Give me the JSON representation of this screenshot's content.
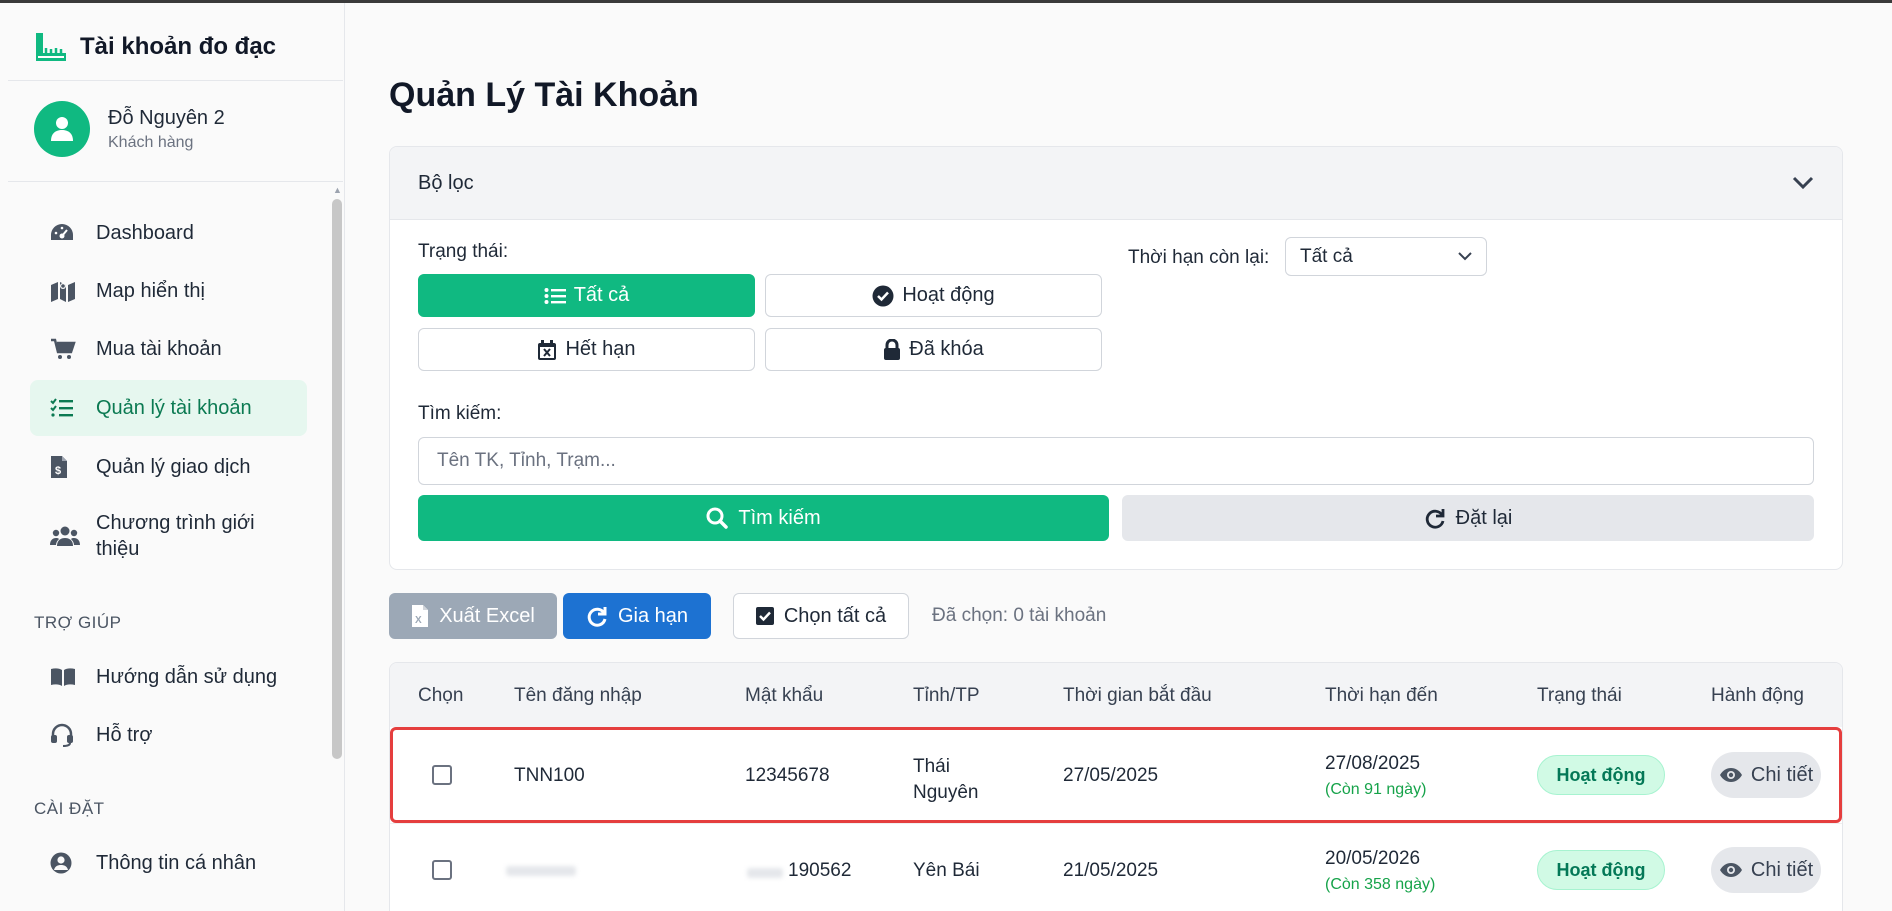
{
  "sidebar": {
    "brand_title": "Tài khoản đo đạc",
    "user": {
      "name": "Đỗ Nguyên 2",
      "role": "Khách hàng"
    },
    "items": [
      {
        "label": "Dashboard",
        "icon": "dashboard-gauge-icon"
      },
      {
        "label": "Map hiển thị",
        "icon": "map-icon"
      },
      {
        "label": "Mua tài khoản",
        "icon": "cart-icon"
      },
      {
        "label": "Quản lý tài khoản",
        "icon": "list-check-icon",
        "active": true
      },
      {
        "label": "Quản lý giao dịch",
        "icon": "invoice-icon"
      },
      {
        "label": "Chương trình giới thiệu",
        "label_line1": "Chương trình giới",
        "label_line2": "thiệu",
        "icon": "users-icon"
      }
    ],
    "help_section": "TRỢ GIÚP",
    "help_items": [
      {
        "label": "Hướng dẫn sử dụng",
        "icon": "book-icon"
      },
      {
        "label": "Hỗ trợ",
        "icon": "headset-icon"
      }
    ],
    "settings_section": "CÀI ĐẶT",
    "settings_items": [
      {
        "label": "Thông tin cá nhân",
        "icon": "user-circle-icon"
      }
    ]
  },
  "main": {
    "title": "Quản Lý Tài Khoản",
    "filter": {
      "header": "Bộ lọc",
      "status_label": "Trạng thái:",
      "status_options": [
        {
          "label": "Tất cả",
          "icon": "list-icon",
          "active": true
        },
        {
          "label": "Hoạt động",
          "icon": "check-circle-icon"
        },
        {
          "label": "Hết hạn",
          "icon": "calendar-x-icon"
        },
        {
          "label": "Đã khóa",
          "icon": "lock-icon"
        }
      ],
      "remaining_label": "Thời hạn còn lại:",
      "remaining_value": "Tất cả",
      "search_label": "Tìm kiếm:",
      "search_placeholder": "Tên TK, Tỉnh, Trạm...",
      "search_button": "Tìm kiếm",
      "reset_button": "Đặt lại"
    },
    "toolbar": {
      "excel": "Xuất Excel",
      "renew": "Gia hạn",
      "select_all": "Chọn tất cả",
      "selected_count": "Đã chọn: 0 tài khoản"
    },
    "table": {
      "headers": [
        "Chọn",
        "Tên đăng nhập",
        "Mật khẩu",
        "Tỉnh/TP",
        "Thời gian bắt đầu",
        "Thời hạn đến",
        "Trạng thái",
        "Hành động"
      ],
      "rows": [
        {
          "username": "TNN100",
          "password": "12345678",
          "province_line1": "Thái",
          "province_line2": "Nguyên",
          "start": "27/05/2025",
          "end": "27/08/2025",
          "remaining": "(Còn 91 ngày)",
          "status": "Hoạt động",
          "action": "Chi tiết"
        },
        {
          "username": "",
          "password": "190562",
          "province_line1": "Yên Bái",
          "province_line2": "",
          "start": "21/05/2025",
          "end": "20/05/2026",
          "remaining": "(Còn 358 ngày)",
          "status": "Hoạt động",
          "action": "Chi tiết"
        }
      ]
    }
  },
  "colors": {
    "accent": "#10b981",
    "renew": "#1d72d2",
    "highlight": "#e53e3e"
  }
}
